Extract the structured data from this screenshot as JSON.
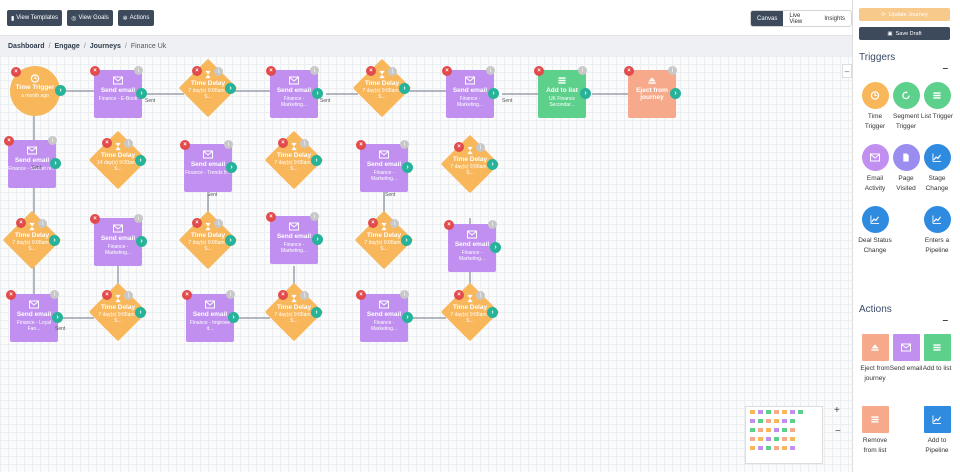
{
  "toolbar": {
    "view_templates": "View Templates",
    "view_goals": "View Goals",
    "actions": "Actions",
    "canvas": "Canvas",
    "live_view": "Live View",
    "insights": "Insights"
  },
  "breadcrumb": [
    "Dashboard",
    "Engage",
    "Journeys",
    "Finance Uk"
  ],
  "sidebar": {
    "update_journey": "Update Journey",
    "save_draft": "Save Draft",
    "triggers_title": "Triggers",
    "actions_title": "Actions",
    "triggers": [
      {
        "label": "Time Trigger",
        "color": "#f7b75a",
        "icon": "clock-icon"
      },
      {
        "label": "Segment Trigger",
        "color": "#5dd08b",
        "icon": "refresh-icon"
      },
      {
        "label": "List Trigger",
        "color": "#5dd08b",
        "icon": "list-icon"
      },
      {
        "label": "Email Activity",
        "color": "#c08ff0",
        "icon": "envelope-icon"
      },
      {
        "label": "Page Visited",
        "color": "#9b8cf0",
        "icon": "page-icon"
      },
      {
        "label": "Stage Change",
        "color": "#2f8be0",
        "icon": "chart-icon"
      },
      {
        "label": "Deal Status Change",
        "color": "#2f8be0",
        "icon": "chart-icon"
      },
      {
        "label": "Enters a Pipeline",
        "color": "#2f8be0",
        "icon": "chart-icon"
      }
    ],
    "actions": [
      {
        "label": "Eject from journey",
        "color": "#f7a98b",
        "icon": "eject-icon"
      },
      {
        "label": "Send email",
        "color": "#c08ff0",
        "icon": "envelope-icon"
      },
      {
        "label": "Add to list",
        "color": "#5dd08b",
        "icon": "list-icon"
      },
      {
        "label": "Remove from list",
        "color": "#f7a98b",
        "icon": "list-icon"
      },
      {
        "label": "Add to Pipeline",
        "color": "#2f8be0",
        "icon": "chart-icon"
      }
    ]
  },
  "canvas": {
    "sent_label": "Sent",
    "zoom_in": "+",
    "zoom_out": "−",
    "time_trigger": {
      "title": "Time Trigger",
      "sub": "a month ago"
    },
    "nodes": [
      {
        "type": "email",
        "title": "Send email",
        "sub": "Finance - E-Book"
      },
      {
        "type": "delay",
        "title": "Time Delay",
        "sub": "7 day(s) 9:00am - S..."
      },
      {
        "type": "email",
        "title": "Send email",
        "sub": "Finance - Marketing..."
      },
      {
        "type": "delay",
        "title": "Time Delay",
        "sub": "7 day(s) 9:00am - S..."
      },
      {
        "type": "email",
        "title": "Send email",
        "sub": "Finance - Marketing..."
      },
      {
        "type": "list",
        "title": "Add to list",
        "sub": "UK Finance Secondar..."
      },
      {
        "type": "eject",
        "title": "Eject from journey",
        "sub": ""
      },
      {
        "type": "email",
        "title": "Send email",
        "sub": "Finance - Market re..."
      },
      {
        "type": "delay",
        "title": "Time Delay",
        "sub": "14 day(s) 9:00am - S..."
      },
      {
        "type": "email",
        "title": "Send email",
        "sub": "Finance - Trends fr..."
      },
      {
        "type": "delay",
        "title": "Time Delay",
        "sub": "7 day(s) 9:00am - S..."
      },
      {
        "type": "email",
        "title": "Send email",
        "sub": "Finance - Marketing..."
      },
      {
        "type": "delay",
        "title": "Time Delay",
        "sub": "7 day(s) 9:00am - S..."
      },
      {
        "type": "delay",
        "title": "Time Delay",
        "sub": "7 day(s) 9:00am - S..."
      },
      {
        "type": "email",
        "title": "Send email",
        "sub": "Finance - Marketing..."
      },
      {
        "type": "delay",
        "title": "Time Delay",
        "sub": "7 day(s) 9:00am - S..."
      },
      {
        "type": "email",
        "title": "Send email",
        "sub": "Finance - Marketing..."
      },
      {
        "type": "delay",
        "title": "Time Delay",
        "sub": "7 day(s) 9:00am - S..."
      },
      {
        "type": "email",
        "title": "Send email",
        "sub": "Finance - Marketing..."
      },
      {
        "type": "email",
        "title": "Send email",
        "sub": "Finance - Loyal Fan..."
      },
      {
        "type": "delay",
        "title": "Time Delay",
        "sub": "7 day(s) 9:00am - S..."
      },
      {
        "type": "email",
        "title": "Send email",
        "sub": "Finance - Improve it..."
      },
      {
        "type": "delay",
        "title": "Time Delay",
        "sub": "7 day(s) 9:00am - S..."
      },
      {
        "type": "email",
        "title": "Send email",
        "sub": "Finance - Marketing..."
      },
      {
        "type": "delay",
        "title": "Time Delay",
        "sub": "7 day(s) 9:00am - S..."
      }
    ]
  },
  "colors": {
    "email": "#c08ff0",
    "delay": "#f7b75a",
    "list": "#5dd08b",
    "eject": "#f7a98b",
    "next": "#27b39a",
    "delete": "#e24b4b",
    "navy": "#3d4a5c"
  }
}
